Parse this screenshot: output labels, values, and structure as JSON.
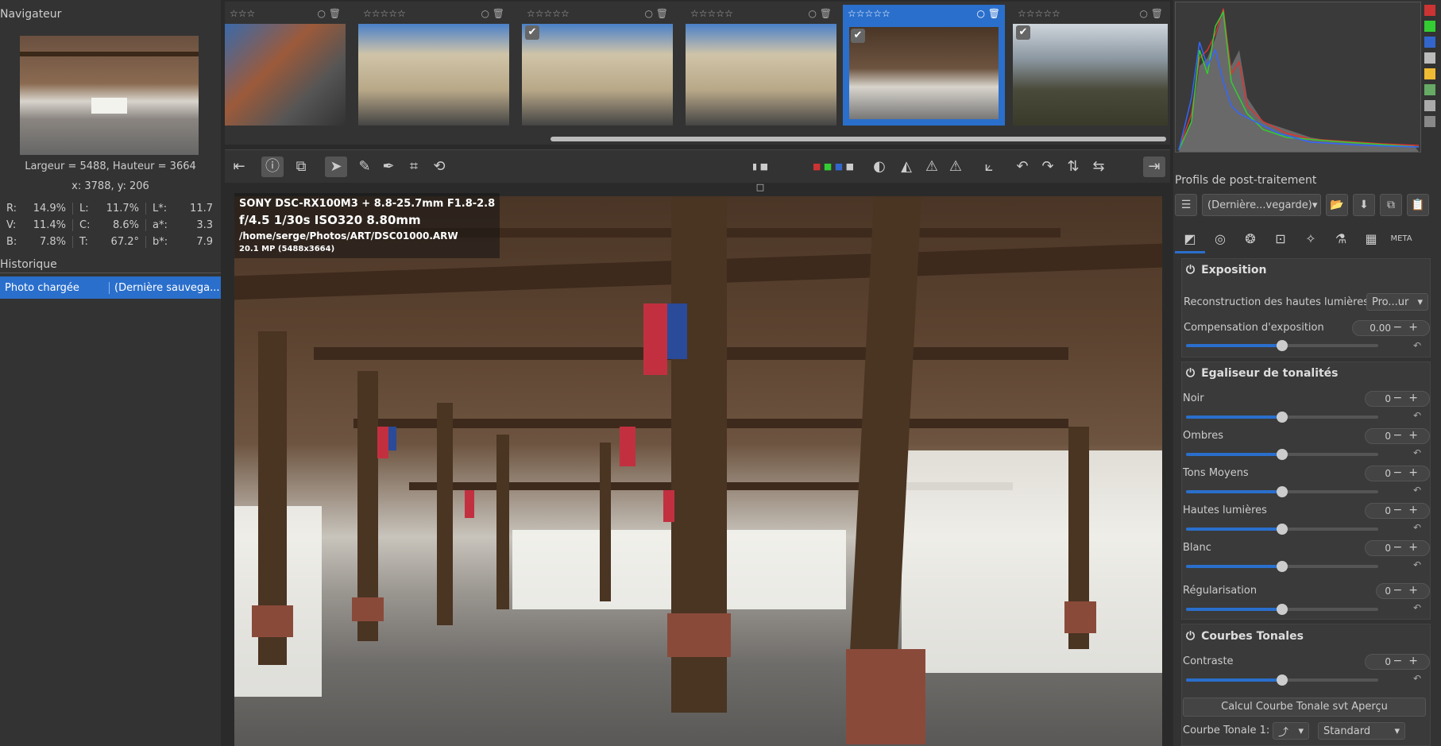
{
  "navigator": {
    "title": "Navigateur",
    "size_text": "Largeur = 5488, Hauteur = 3664",
    "coords_text": "x: 3788, y: 206",
    "values": [
      [
        [
          "R:",
          "14.9%"
        ],
        [
          "L:",
          "11.7%"
        ],
        [
          "L*:",
          "11.7"
        ]
      ],
      [
        [
          "V:",
          "11.4%"
        ],
        [
          "C:",
          "8.6%"
        ],
        [
          "a*:",
          "3.3"
        ]
      ],
      [
        [
          "B:",
          "7.8%"
        ],
        [
          "T:",
          "67.2°"
        ],
        [
          "b*:",
          "7.9"
        ]
      ]
    ]
  },
  "history": {
    "title": "Historique",
    "row_label": "Photo chargée",
    "row_value": "(Dernière sauvega..."
  },
  "filmstrip": {
    "stars": "☆☆☆☆☆",
    "stars_short": "☆☆☆",
    "selected_index": 4
  },
  "image_info": {
    "camera": "SONY DSC-RX100M3 + 8.8-25.7mm F1.8-2.8",
    "exposure": "f/4.5  1/30s  ISO320  8.80mm",
    "path_prefix": "/home/serge/Photos/ART/",
    "filename": "DSC01000.ARW",
    "resolution": "20.1 MP (5488x3664)"
  },
  "right": {
    "profiles_title": "Profils de post-traitement",
    "profile_combo": "(Dernière...vegarde)",
    "exposure": {
      "title": "Exposition",
      "hl_recon_label": "Reconstruction des hautes lumières:",
      "hl_recon_value": "Pro...ur",
      "comp_label": "Compensation d'exposition",
      "comp_value": "0.00"
    },
    "tone_eq": {
      "title": "Egaliseur de tonalités",
      "noir": "Noir",
      "ombres": "Ombres",
      "tons_moyens": "Tons Moyens",
      "hautes_lumieres": "Hautes lumières",
      "blanc": "Blanc",
      "regularisation": "Régularisation",
      "zero": "0"
    },
    "curves": {
      "title": "Courbes Tonales",
      "contraste": "Contraste",
      "zero": "0",
      "calc_button": "Calcul Courbe Tonale svt Aperçu",
      "curve1_label": "Courbe Tonale 1:",
      "curve1_value": "Standard"
    },
    "slider_levels": {
      "comp": 0.5,
      "noir": 0.5,
      "ombres": 0.5,
      "tons": 0.5,
      "hautes": 0.5,
      "blanc": 0.5,
      "reg": 0.5,
      "contraste": 0.5
    }
  },
  "colors": {
    "accent": "#2a6fcc",
    "panel": "#333333",
    "background": "#2a2a2a"
  }
}
